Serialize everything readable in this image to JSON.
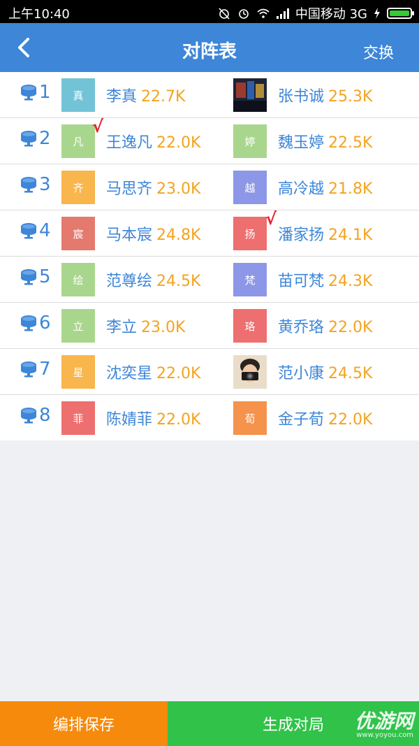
{
  "status_bar": {
    "time": "上午10:40",
    "carrier": "中国移动 3G"
  },
  "nav": {
    "title": "对阵表",
    "swap_label": "交换"
  },
  "colors": {
    "primary": "#3d86d8",
    "score": "#f3a31f",
    "check": "#e5212b",
    "save_btn": "#f58a0c",
    "generate_btn": "#31c24a"
  },
  "check_mark": "√",
  "rows": [
    {
      "seat": "1",
      "left": {
        "avatar_char": "真",
        "avatar_color": "#73c3d7",
        "name": "李真",
        "score": "22.7K",
        "checked": false
      },
      "right": {
        "avatar_char": "",
        "avatar_color": "#1e2a4a",
        "photo": "stage-photo",
        "name": "张书诚",
        "score": "25.3K",
        "checked": false
      }
    },
    {
      "seat": "2",
      "left": {
        "avatar_char": "凡",
        "avatar_color": "#a9d68d",
        "name": "王逸凡",
        "score": "22.0K",
        "checked": true
      },
      "right": {
        "avatar_char": "婷",
        "avatar_color": "#a9d68d",
        "name": "魏玉婷",
        "score": "22.5K",
        "checked": false
      }
    },
    {
      "seat": "3",
      "left": {
        "avatar_char": "齐",
        "avatar_color": "#f8b64c",
        "name": "马思齐",
        "score": "23.0K",
        "checked": false
      },
      "right": {
        "avatar_char": "越",
        "avatar_color": "#8c97e7",
        "name": "高冷越",
        "score": "21.8K",
        "checked": false
      }
    },
    {
      "seat": "4",
      "left": {
        "avatar_char": "宸",
        "avatar_color": "#e47a6e",
        "name": "马本宸",
        "score": "24.8K",
        "checked": false
      },
      "right": {
        "avatar_char": "扬",
        "avatar_color": "#ee6f6f",
        "name": "潘家扬",
        "score": "24.1K",
        "checked": true
      }
    },
    {
      "seat": "5",
      "left": {
        "avatar_char": "绘",
        "avatar_color": "#a9d68d",
        "name": "范尊绘",
        "score": "24.5K",
        "checked": false
      },
      "right": {
        "avatar_char": "梵",
        "avatar_color": "#8c97e7",
        "name": "苗可梵",
        "score": "24.3K",
        "checked": false
      }
    },
    {
      "seat": "6",
      "left": {
        "avatar_char": "立",
        "avatar_color": "#a9d68d",
        "name": "李立",
        "score": "23.0K",
        "checked": false
      },
      "right": {
        "avatar_char": "珞",
        "avatar_color": "#ee6f6f",
        "name": "黄乔珞",
        "score": "22.0K",
        "checked": false
      }
    },
    {
      "seat": "7",
      "left": {
        "avatar_char": "星",
        "avatar_color": "#f8b64c",
        "name": "沈奕星",
        "score": "22.0K",
        "checked": false
      },
      "right": {
        "avatar_char": "",
        "avatar_color": "#d9c7b0",
        "photo": "camera-photo",
        "name": "范小康",
        "score": "24.5K",
        "checked": false
      }
    },
    {
      "seat": "8",
      "left": {
        "avatar_char": "菲",
        "avatar_color": "#ee6f6f",
        "name": "陈婧菲",
        "score": "22.0K",
        "checked": false
      },
      "right": {
        "avatar_char": "荀",
        "avatar_color": "#f5924c",
        "name": "金子荀",
        "score": "22.0K",
        "checked": false
      }
    }
  ],
  "bottom": {
    "save_label": "编排保存",
    "generate_label": "生成对局"
  },
  "watermark": {
    "main": "优游网",
    "sub": "www.yoyou.com"
  }
}
